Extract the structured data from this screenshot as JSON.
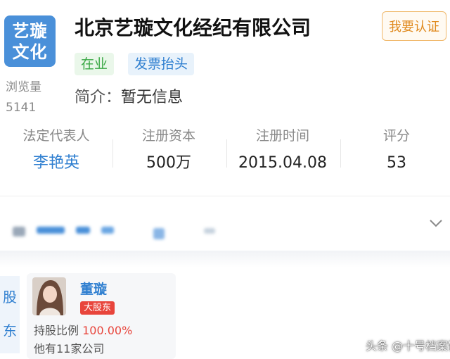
{
  "company": {
    "logo_line1": "艺璇",
    "logo_line2": "文化",
    "name": "北京艺璇文化经纪有限公司",
    "views_label": "浏览量",
    "views_count": "5141",
    "verify_button": "我要认证",
    "status_tag": "在业",
    "invoice_tag": "发票抬头",
    "intro_label": "简介：",
    "intro_value": "暂无信息"
  },
  "stats": [
    {
      "label": "法定代表人",
      "value": "李艳英"
    },
    {
      "label": "注册资本",
      "value": "500万"
    },
    {
      "label": "注册时间",
      "value": "2015.04.08"
    },
    {
      "label": "评分",
      "value": "53"
    }
  ],
  "shareholder_section": {
    "side_label_1": "股",
    "side_label_2": "东",
    "name": "董璇",
    "badge": "大股东",
    "ratio_label": "持股比例",
    "ratio_value": "100.00%",
    "other_companies": "他有11家公司"
  },
  "watermark": "头条 @十号档案馆",
  "colors": {
    "brand_blue": "#2f7fd0",
    "logo_bg": "#4a90d9",
    "status_green": "#3aa845",
    "badge_red": "#e8453c",
    "verify_orange": "#e08a1e"
  },
  "icons": {
    "expand": "chevron-down-icon"
  }
}
